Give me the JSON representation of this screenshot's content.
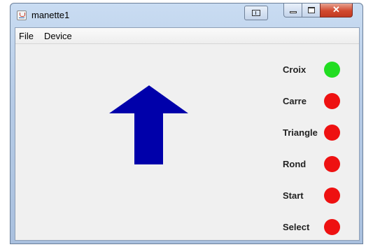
{
  "window": {
    "title": "manette1"
  },
  "menubar": {
    "items": [
      {
        "label": "File"
      },
      {
        "label": "Device"
      }
    ]
  },
  "direction_indicator": {
    "direction": "up",
    "color": "#0000aa"
  },
  "buttons": [
    {
      "label": "Croix",
      "state": "pressed",
      "color": "#22dd22"
    },
    {
      "label": "Carre",
      "state": "released",
      "color": "#ee1111"
    },
    {
      "label": "Triangle",
      "state": "released",
      "color": "#ee1111"
    },
    {
      "label": "Rond",
      "state": "released",
      "color": "#ee1111"
    },
    {
      "label": "Start",
      "state": "released",
      "color": "#ee1111"
    },
    {
      "label": "Select",
      "state": "released",
      "color": "#ee1111"
    }
  ]
}
